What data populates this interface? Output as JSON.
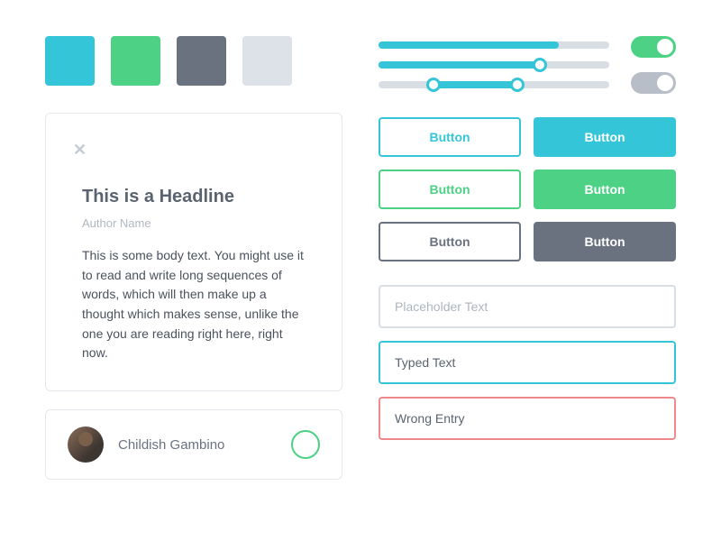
{
  "colors": {
    "cyan": "#34c6d8",
    "green": "#4cd185",
    "dark_gray": "#6a7280",
    "light_gray": "#dde2e8",
    "error": "#f08a8a"
  },
  "swatches": [
    "#34c6d8",
    "#4cd185",
    "#6a7280",
    "#dde2e8"
  ],
  "sliders": [
    {
      "type": "progress",
      "value": 78
    },
    {
      "type": "single",
      "value": 70
    },
    {
      "type": "range",
      "min": 24,
      "max": 60
    }
  ],
  "toggles": [
    {
      "state": "on"
    },
    {
      "state": "off"
    }
  ],
  "card": {
    "headline": "This is a Headline",
    "author": "Author Name",
    "body": "This is some body text. You might use it to read and write long sequences of words, which will then make up a thought which makes sense, unlike the one you are reading right here, right now."
  },
  "profile": {
    "name": "Childish Gambino"
  },
  "buttons": {
    "outline_cyan": "Button",
    "fill_cyan": "Button",
    "outline_green": "Button",
    "fill_green": "Button",
    "outline_gray": "Button",
    "fill_gray": "Button"
  },
  "inputs": {
    "placeholder": "Placeholder Text",
    "typed": "Typed Text",
    "error": "Wrong Entry"
  }
}
